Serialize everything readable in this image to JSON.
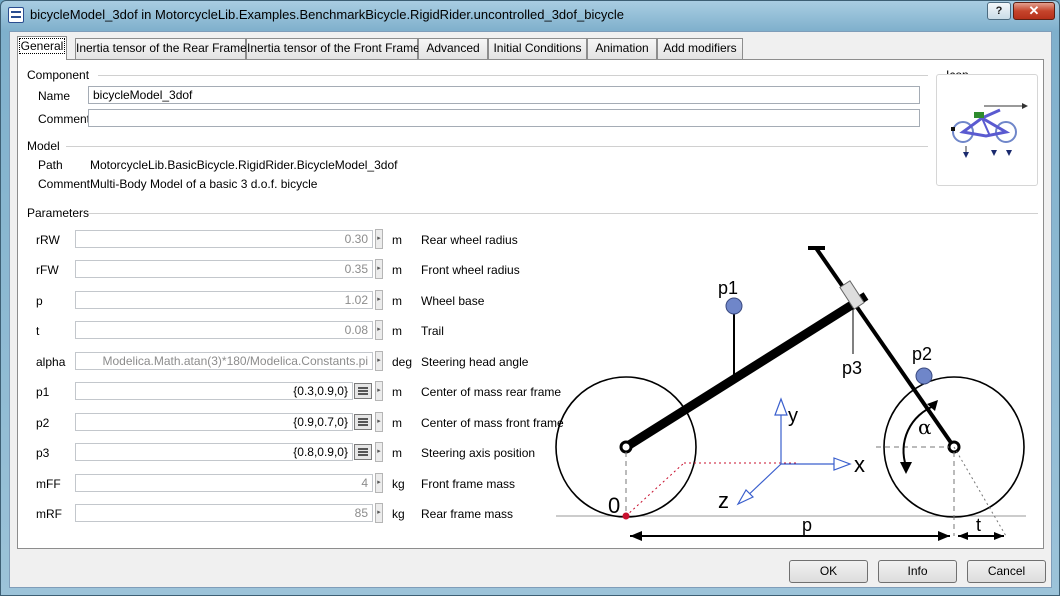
{
  "window": {
    "title": "bicycleModel_3dof in MotorcycleLib.Examples.BenchmarkBicycle.RigidRider.uncontrolled_3dof_bicycle",
    "help_label": "?",
    "close_label": "✕"
  },
  "tabs": [
    {
      "label": "General"
    },
    {
      "label": "Inertia tensor of the Rear Frame"
    },
    {
      "label": "Inertia tensor of the Front Frame"
    },
    {
      "label": "Advanced"
    },
    {
      "label": "Initial Conditions"
    },
    {
      "label": "Animation"
    },
    {
      "label": "Add modifiers"
    }
  ],
  "component": {
    "heading": "Component",
    "name_label": "Name",
    "name_value": "bicycleModel_3dof",
    "comment_label": "Comment",
    "comment_value": ""
  },
  "icon": {
    "heading": "Icon"
  },
  "model": {
    "heading": "Model",
    "path_label": "Path",
    "path_value": "MotorcycleLib.BasicBicycle.RigidRider.BicycleModel_3dof",
    "comment_label": "Comment",
    "comment_value": "Multi-Body Model of a basic 3 d.o.f. bicycle"
  },
  "parameters": {
    "heading": "Parameters",
    "rows": [
      {
        "name": "rRW",
        "value": "0.30",
        "unit": "m",
        "description": "Rear wheel radius"
      },
      {
        "name": "rFW",
        "value": "0.35",
        "unit": "m",
        "description": "Front wheel radius"
      },
      {
        "name": "p",
        "value": "1.02",
        "unit": "m",
        "description": "Wheel base"
      },
      {
        "name": "t",
        "value": "0.08",
        "unit": "m",
        "description": "Trail"
      },
      {
        "name": "alpha",
        "value": "Modelica.Math.atan(3)*180/Modelica.Constants.pi",
        "unit": "deg",
        "description": "Steering head angle"
      },
      {
        "name": "p1",
        "value": "{0.3,0.9,0}",
        "unit": "m",
        "description": "Center of mass rear frame"
      },
      {
        "name": "p2",
        "value": "{0.9,0.7,0}",
        "unit": "m",
        "description": "Center of mass front frame"
      },
      {
        "name": "p3",
        "value": "{0.8,0.9,0}",
        "unit": "m",
        "description": "Steering axis position"
      },
      {
        "name": "mFF",
        "value": "4",
        "unit": "kg",
        "description": "Front frame mass"
      },
      {
        "name": "mRF",
        "value": "85",
        "unit": "kg",
        "description": "Rear frame mass"
      }
    ]
  },
  "diagram": {
    "labels": {
      "p1": "p1",
      "p2": "p2",
      "p3": "p3",
      "x": "x",
      "y": "y",
      "z": "z",
      "zero": "0",
      "p": "p",
      "t": "t",
      "alpha": "α"
    }
  },
  "buttons": {
    "ok": "OK",
    "info": "Info",
    "cancel": "Cancel"
  },
  "colors": {
    "accent_red": "#c8102e",
    "axis_blue": "#3a5fcd",
    "mass_blue": "#6f86c9"
  }
}
